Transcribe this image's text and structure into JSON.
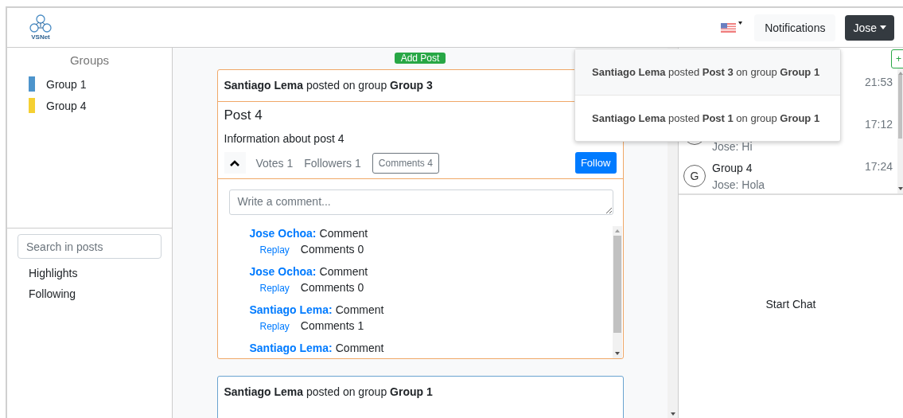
{
  "header": {
    "logo_text": "VSNet",
    "notifications_button": "Notifications",
    "user_button": "Jose"
  },
  "notifications": [
    {
      "text": "**Santiago Lema** posted **Post 3** on group **Group 1**",
      "selected": true
    },
    {
      "text": "**Santiago Lema** posted **Post 1** on group **Group 1**",
      "selected": false
    }
  ],
  "groups": {
    "title": "Groups",
    "items": [
      {
        "name": "Group 1",
        "color": "#4d94cc"
      },
      {
        "name": "Group 4",
        "color": "#f5d033"
      }
    ]
  },
  "search": {
    "placeholder": "Search in posts"
  },
  "filters": [
    {
      "label": "Highlights"
    },
    {
      "label": "Following"
    }
  ],
  "feed": {
    "add_post": "Add Post",
    "posts": [
      {
        "header": "**Santiago Lema** posted on group **Group 3**",
        "expanded": true,
        "title": "Post 4",
        "info": "Information about post 4",
        "votes": "Votes 1",
        "followers": "Followers 1",
        "comments_button": "Comments 4",
        "follow_button": "Follow",
        "comment_placeholder": "Write a comment...",
        "comments": [
          {
            "author": "Jose Ochoa:",
            "text": "Comment",
            "reply": "Replay",
            "count": "Comments 0"
          },
          {
            "author": "Jose Ochoa:",
            "text": "Comment",
            "reply": "Replay",
            "count": "Comments 0"
          },
          {
            "author": "Santiago Lema:",
            "text": "Comment",
            "reply": "Replay",
            "count": "Comments 1"
          },
          {
            "author": "Santiago Lema:",
            "text": "Comment"
          }
        ]
      },
      {
        "header": "**Santiago Lema** posted on group **Group 1**",
        "expanded": false
      }
    ]
  },
  "chats": {
    "add_button": "+",
    "items": [
      {
        "time": "21:53"
      },
      {
        "preview": "Jose: Hi",
        "time": "17:12"
      },
      {
        "avatar": "G",
        "name": "Group 4",
        "preview": "Jose: Hola",
        "time": "17:24"
      }
    ],
    "empty_text": "Start Chat"
  }
}
